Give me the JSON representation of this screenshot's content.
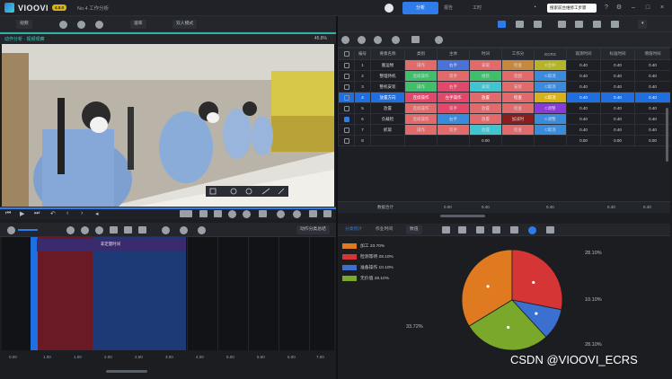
{
  "app": {
    "name": "VIOOVI",
    "version_badge": "4.0.0",
    "doc_title": "No.4 工作分析"
  },
  "title_tabs": [
    "分析",
    "报告",
    "工时"
  ],
  "title_input_value": "搜索前台维修工步骤",
  "toolbar_left": {
    "project_dropdown": "视频",
    "speed_dropdown": "速率",
    "mode_dropdown": "双人模式"
  },
  "video": {
    "title": "动作分析 · 视频观察",
    "zoom": "45.8%",
    "colors": {
      "accent": "#2fb3a3",
      "scene_bg": "#c9c3b6"
    }
  },
  "table": {
    "headers": [
      "",
      "编号",
      "要素名称",
      "类别",
      "主体",
      "时间",
      "工作分",
      "ECRS",
      "观测时间",
      "标准时间",
      "增值时间"
    ],
    "rows": [
      {
        "checked": false,
        "selected": false,
        "no": "1",
        "name": "搬运物",
        "cat": "操作",
        "cat_color": "#e36a6a",
        "subj": "右手",
        "subj_color": "#4a72d8",
        "time": "拿取",
        "time_color": "#e36a6a",
        "op": "检查",
        "op_color": "#c6883a",
        "ecrs": "E合并",
        "ecrs_color": "#b6b427",
        "obs": "0.40",
        "std": "0.40",
        "val": "0.40"
      },
      {
        "checked": false,
        "selected": false,
        "no": "2",
        "name": "整理持机",
        "cat": "连续操作",
        "cat_color": "#3fbf6a",
        "subj": "双手",
        "subj_color": "#e36a6a",
        "time": "组装",
        "time_color": "#3fbf6a",
        "op": "装配",
        "op_color": "#e36a6a",
        "ecrs": "C取消",
        "ecrs_color": "#3a8bdc",
        "obs": "0.40",
        "std": "0.40",
        "val": "0.40"
      },
      {
        "checked": false,
        "selected": false,
        "no": "3",
        "name": "整机安装",
        "cat": "操作",
        "cat_color": "#3fbf6a",
        "subj": "右手",
        "subj_color": "#e3476a",
        "time": "拿取",
        "time_color": "#3fc4d0",
        "op": "安装",
        "op_color": "#e36a6a",
        "ecrs": "C取消",
        "ecrs_color": "#3a8bdc",
        "obs": "0.40",
        "std": "0.40",
        "val": "0.40"
      },
      {
        "checked": false,
        "selected": true,
        "no": "4",
        "name": "放置方向",
        "cat": "连续操作",
        "cat_color": "#e3476a",
        "subj": "左手操作",
        "subj_color": "#e3476a",
        "time": "放置",
        "time_color": "#e36a6a",
        "op": "检查",
        "op_color": "#e36a6a",
        "ecrs": "C取消",
        "ecrs_color": "#d8b21a",
        "obs": "0.40",
        "std": "0.40",
        "val": "0.40"
      },
      {
        "checked": false,
        "selected": false,
        "no": "5",
        "name": "放置",
        "cat": "连续操作",
        "cat_color": "#e36a6a",
        "subj": "双手",
        "subj_color": "#e3476a",
        "time": "放置",
        "time_color": "#e36a6a",
        "op": "检查",
        "op_color": "#e36a6a",
        "ecrs": "C调整",
        "ecrs_color": "#8a3ad8",
        "obs": "0.40",
        "std": "0.40",
        "val": "0.40"
      },
      {
        "checked": true,
        "selected": false,
        "no": "6",
        "name": "负载检",
        "cat": "连续操作",
        "cat_color": "#e36a6a",
        "subj": "右手",
        "subj_color": "#3a8bdc",
        "time": "放置",
        "time_color": "#e36a6a",
        "op": "加减时",
        "op_color": "#8a1e1e",
        "ecrs": "C调整",
        "ecrs_color": "#3a8bdc",
        "obs": "0.40",
        "std": "0.40",
        "val": "0.40"
      },
      {
        "checked": false,
        "selected": false,
        "no": "7",
        "name": "抓取",
        "cat": "操作",
        "cat_color": "#e36a6a",
        "subj": "双手",
        "subj_color": "#e36a6a",
        "time": "放置",
        "time_color": "#3fc4d0",
        "op": "检查",
        "op_color": "#e36a6a",
        "ecrs": "C取消",
        "ecrs_color": "#3a8bdc",
        "obs": "0.40",
        "std": "0.40",
        "val": "0.40"
      },
      {
        "checked": false,
        "selected": false,
        "no": "8",
        "name": "",
        "cat": "",
        "cat_color": "",
        "subj": "",
        "subj_color": "",
        "time": "0.00",
        "time_color": "",
        "op": "",
        "op_color": "",
        "ecrs": "",
        "ecrs_color": "",
        "obs": "0.00",
        "std": "0.00",
        "val": "0.00"
      }
    ],
    "summary": {
      "label": "数据合计",
      "c1": "0.00",
      "c2": "0.40",
      "c3": "0.40",
      "c4": "0.40",
      "c5": "0.40"
    }
  },
  "timeline": {
    "zoom_label": "动作分类总结",
    "segment_label": "非定量时间",
    "ticks": [
      "0.00",
      "1.00",
      "1.00",
      "2.00",
      "2.50",
      "3.00",
      "4.00",
      "5.00",
      "5.50",
      "6.00",
      "7.00"
    ]
  },
  "chart_tabs": [
    "分类统计",
    "作业时间",
    "数值"
  ],
  "chart_data": {
    "type": "pie",
    "title": "",
    "slices": [
      {
        "label": "加工 33.70%",
        "value": 33.72,
        "color": "#e07a21"
      },
      {
        "label": "检测等待 28.10%",
        "value": 28.1,
        "color": "#d63535"
      },
      {
        "label": "准备操作 10.10%",
        "value": 10.1,
        "color": "#3b6fd0"
      },
      {
        "label": "无价值 28.10%",
        "value": 28.1,
        "color": "#79a82b"
      }
    ],
    "outer_labels": [
      "28.10%",
      "10.10%",
      "28.10%",
      "33.72%"
    ],
    "legend_placement": "left"
  },
  "watermark": "CSDN @VIOOVI_ECRS"
}
